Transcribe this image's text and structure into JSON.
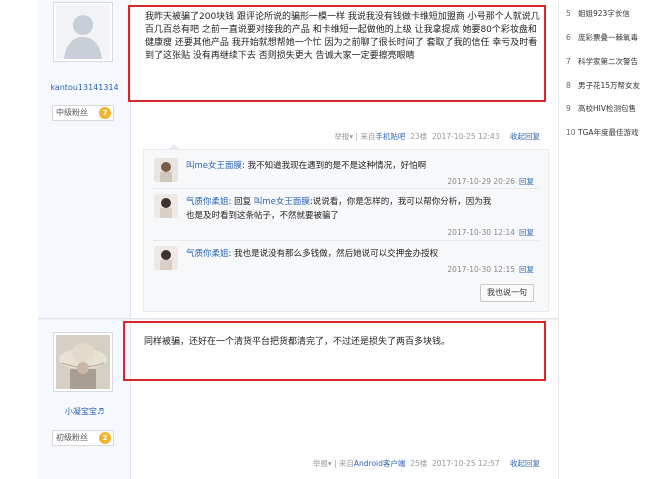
{
  "post1": {
    "username": "kantou13141314",
    "fan_label": "中级粉丝",
    "fan_level": "7",
    "content": "我昨天被骗了200块钱 跟评论所说的骗形一模一样 我说我没有钱做卡维短加盟商 小号那个人就说几百几百总有吧 之前一直说要对接我的产品 和卡维短一起做他的上级 让我拿提成 她要80个彩妆盘和健康瘦 还要其他产品 我开始就想帮她一个忙 因为之前聊了很长时间了 套取了我的信任 幸亏及时看到了这张贴 没有再继续下去 否则损失更大 告诚大家一定要擦亮眼睛",
    "report": "举报",
    "from_label": "来自",
    "from_client": "手机贴吧",
    "floor": "23楼",
    "time": "2017-10-25 12:43",
    "reply_label": "收起回复"
  },
  "lzl": {
    "items": [
      {
        "name": "叫me女王面膜",
        "text": "我不知道我现在遇到的是不是这种情况，好怕啊",
        "time": "2017-10-29 20:26",
        "reply": "回复"
      },
      {
        "name": "气质你柔姐",
        "reply_prefix": "回复",
        "reply_to": "叫me女王面膜",
        "text_line1": ":说说看，你是怎样的，我可以帮你分析，因为我",
        "text_line2": "也是及时看到这条帖子，不然就要被骗了",
        "time": "2017-10-30 12:14",
        "reply": "回复"
      },
      {
        "name": "气质你柔姐",
        "text": "我也是说没有那么多钱做，然后她说可以交押金办授权",
        "time": "2017-10-30 12:15",
        "reply": "回复"
      }
    ],
    "say_button": "我也说一句"
  },
  "post2": {
    "username": "小凝宝宝",
    "fan_label": "初级粉丝",
    "fan_level": "2",
    "content": "同样被骗，还好在一个清货平台把货都清完了，不过还是损失了两百多块钱。",
    "report": "举报",
    "from_label": "来自",
    "from_client": "Android客户端",
    "floor": "25楼",
    "time": "2017-10-25 12:57",
    "reply_label": "收起回复"
  },
  "sidebar": {
    "items": [
      {
        "num": "5",
        "text": "姐姐923字长信"
      },
      {
        "num": "6",
        "text": "庞彩票叠一棘氧毒"
      },
      {
        "num": "7",
        "text": "科学家第二次警告"
      },
      {
        "num": "8",
        "text": "男子花15万帮女友"
      },
      {
        "num": "9",
        "text": "高校HIV检测包售"
      },
      {
        "num": "10",
        "text": "TGA年度最佳游戏"
      }
    ]
  },
  "colors": {
    "highlight_box": "#d9262b",
    "link": "#2d64b3",
    "badge": "#f0b52d"
  }
}
